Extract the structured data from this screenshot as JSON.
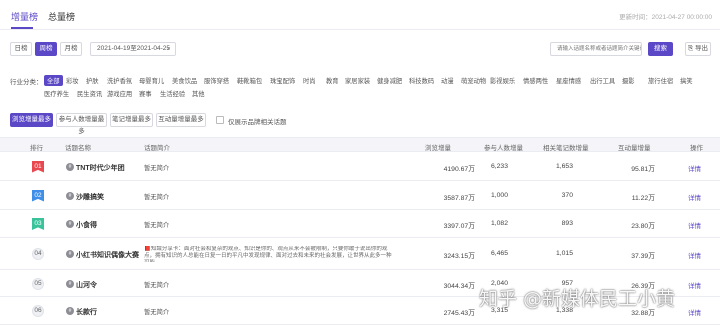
{
  "tabs": [
    "增量榜",
    "总量榜"
  ],
  "update_time": "更新时间：2021-04-27 00:00:00",
  "period_buttons": [
    "日榜",
    "周榜",
    "月榜"
  ],
  "date_range": "2021-04-19至2021-04-25",
  "search": {
    "placeholder": "请输入话题名称或者话题简介关键词",
    "button": "搜索"
  },
  "export_label": "导出",
  "category_label": "行业分类：",
  "categories_row1": [
    "全部",
    "彩妆",
    "护肤",
    "洗护香氛",
    "母婴育儿",
    "美食饮品",
    "服饰穿搭",
    "鞋靴箱包",
    "珠宝配饰",
    "时尚",
    "教育",
    "家居家装",
    "健身减肥",
    "科技数码",
    "动漫",
    "萌宠动物",
    "影视娱乐",
    "情感两性",
    "星座情感",
    "出行工具",
    "摄影",
    "旅行住宿",
    "搞笑"
  ],
  "categories_row2": [
    "医疗养生",
    "民生资讯",
    "游戏应用",
    "赛事",
    "生活经验",
    "其他"
  ],
  "sort_buttons": [
    "浏览增量最多",
    "参与人数增量最多",
    "笔记增量最多",
    "互动量增量最多"
  ],
  "brand_only_label": "仅展示品牌相关话题",
  "columns": [
    "排行",
    "话题名称",
    "话题简介",
    "浏览增量",
    "参与人数增量",
    "相关笔记数增量",
    "互动量增量",
    "操作"
  ],
  "rows": [
    {
      "rank": "01",
      "name": "TNT时代少年团",
      "intro": "暂无简介",
      "views": "4190.67万",
      "participants": "6,233",
      "notes": "1,653",
      "interactions": "95.81万",
      "action": "详情"
    },
    {
      "rank": "02",
      "name": "沙雕搞笑",
      "intro": "暂无简介",
      "views": "3587.87万",
      "participants": "1,000",
      "notes": "370",
      "interactions": "11.22万",
      "action": "详情"
    },
    {
      "rank": "03",
      "name": "小食得",
      "intro": "暂无简介",
      "views": "3397.07万",
      "participants": "1,082",
      "notes": "893",
      "interactions": "23.80万",
      "action": "详情"
    },
    {
      "rank": "04",
      "name": "小红书知识偶像大赛",
      "intro": "📕知識分享卡：面对社会和复杂的观点、知识是你的、观点从来不会被限制，只要你敢于说出你的观点，拥有知识的人总能在日复一日的平凡中发现规律、面对过去和未来的社会发展，让世界从此多一种可能",
      "views": "3243.15万",
      "participants": "6,465",
      "notes": "1,015",
      "interactions": "37.39万",
      "action": "详情"
    },
    {
      "rank": "05",
      "name": "山河令",
      "intro": "暂无简介",
      "views": "3044.34万",
      "participants": "2,040",
      "notes": "957",
      "interactions": "26.39万",
      "action": "详情"
    },
    {
      "rank": "06",
      "name": "长款行",
      "intro": "暂无简介",
      "views": "2745.43万",
      "participants": "3,315",
      "notes": "1,338",
      "interactions": "32.88万",
      "action": "详情"
    }
  ],
  "rank_colors": [
    "#e8484f",
    "#3f8ee8",
    "#3ac29a"
  ],
  "watermark": "知乎 @新媒体民工小黄"
}
